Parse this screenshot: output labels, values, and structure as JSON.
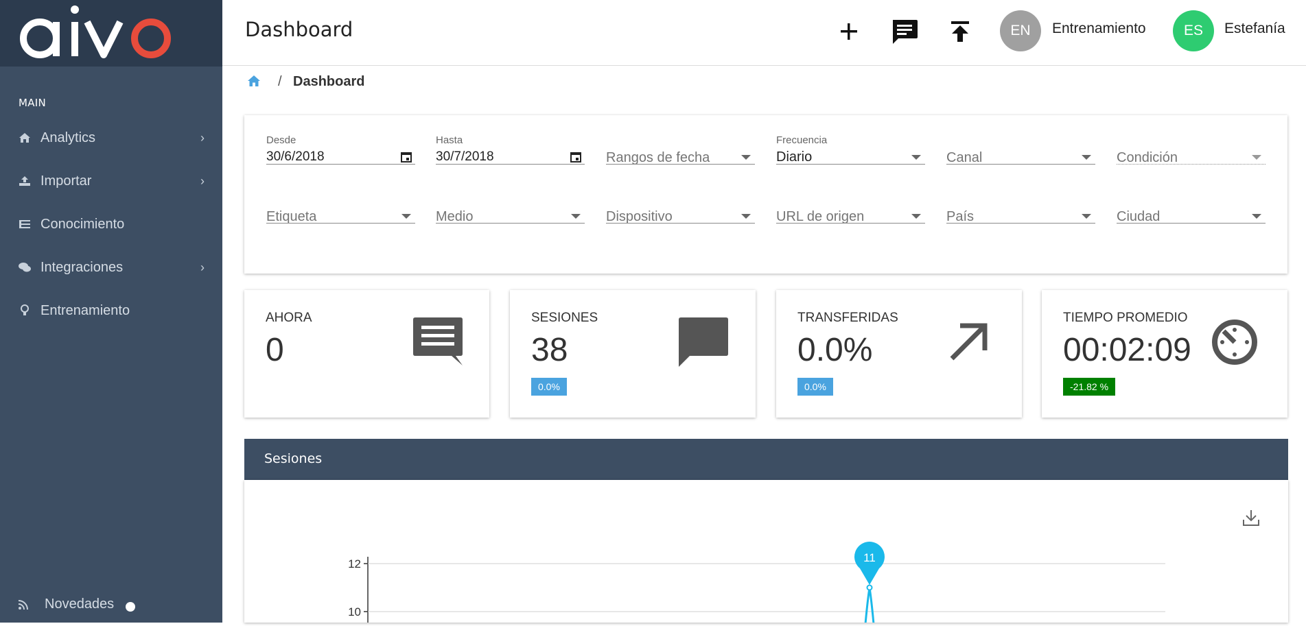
{
  "app": {
    "logo_text": "aivo"
  },
  "sidebar": {
    "section_label": "MAIN",
    "items": [
      {
        "label": "Analytics",
        "icon": "home-icon",
        "has_children": true
      },
      {
        "label": "Importar",
        "icon": "upload-icon",
        "has_children": true
      },
      {
        "label": "Conocimiento",
        "icon": "list-icon",
        "has_children": false
      },
      {
        "label": "Integraciones",
        "icon": "chat-icon",
        "has_children": true
      },
      {
        "label": "Entrenamiento",
        "icon": "lightbulb-icon",
        "has_children": false
      }
    ],
    "footer": {
      "label": "Novedades",
      "icon": "rss-icon"
    }
  },
  "header": {
    "title": "Dashboard",
    "users": [
      {
        "initials": "EN",
        "name": "Entrenamiento",
        "color": "#9e9e9e"
      },
      {
        "initials": "ES",
        "name": "Estefanía",
        "color": "#2ecc71"
      }
    ]
  },
  "breadcrumb": {
    "separator": "/",
    "current": "Dashboard"
  },
  "filters": {
    "desde": {
      "label": "Desde",
      "value": "30/6/2018"
    },
    "hasta": {
      "label": "Hasta",
      "value": "30/7/2018"
    },
    "rangos": {
      "placeholder": "Rangos de fecha"
    },
    "frecuencia": {
      "label": "Frecuencia",
      "value": "Diario"
    },
    "canal": {
      "placeholder": "Canal"
    },
    "condicion": {
      "placeholder": "Condición"
    },
    "etiqueta": {
      "placeholder": "Etiqueta"
    },
    "medio": {
      "placeholder": "Medio"
    },
    "dispositivo": {
      "placeholder": "Dispositivo"
    },
    "url": {
      "placeholder": "URL de origen"
    },
    "pais": {
      "placeholder": "País"
    },
    "ciudad": {
      "placeholder": "Ciudad"
    }
  },
  "stats": [
    {
      "title": "AHORA",
      "value": "0",
      "badge": null,
      "icon": "message-icon"
    },
    {
      "title": "SESIONES",
      "value": "38",
      "badge": "0.0%",
      "badge_color": "#4aa3df",
      "icon": "chat-bubble-icon"
    },
    {
      "title": "TRANSFERIDAS",
      "value": "0.0%",
      "badge": "0.0%",
      "badge_color": "#4aa3df",
      "icon": "arrow-up-right-icon"
    },
    {
      "title": "TIEMPO PROMEDIO",
      "value": "00:02:09",
      "badge": "-21.82 %",
      "badge_color": "#008000",
      "icon": "timer-icon"
    }
  ],
  "sessions_chart": {
    "title": "Sesiones",
    "download_icon": "download-icon"
  },
  "chart_data": {
    "type": "line",
    "yticks": [
      10,
      12
    ],
    "peak_label": "11",
    "series": [
      {
        "values": [
          11
        ]
      }
    ],
    "color": "#1ab9ea"
  }
}
